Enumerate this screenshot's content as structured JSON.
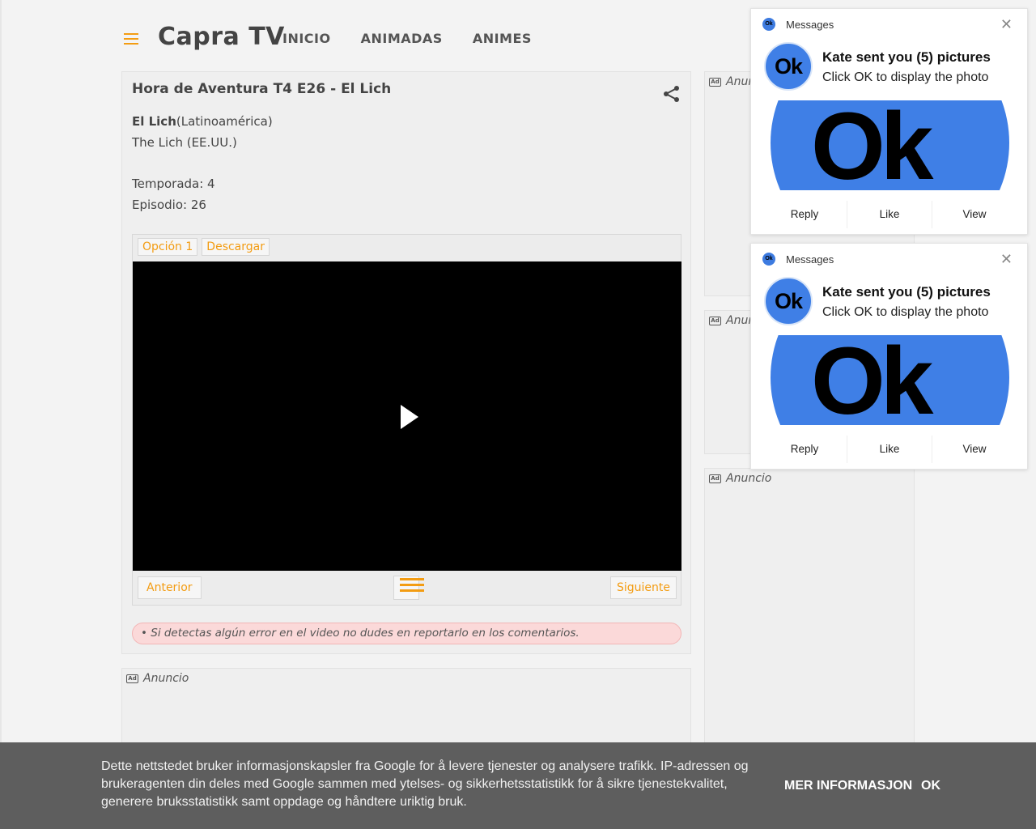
{
  "header": {
    "site_title": "Capra TV",
    "nav": [
      "INICIO",
      "ANIMADAS",
      "ANIMES"
    ]
  },
  "post": {
    "title": "Hora de Aventura T4 E26 - El Lich",
    "name_latam_bold": "El Lich",
    "name_latam_region": "(Latinoamérica)",
    "name_us": "The Lich (EE.UU.)",
    "season": "Temporada: 4",
    "episode": "Episodio: 26",
    "options": [
      "Opción 1",
      "Descargar"
    ],
    "prev_label": "Anterior",
    "next_label": "Siguiente",
    "error_note": "• Si detectas algún error en el video no dudes en reportarlo en los comentarios."
  },
  "ads": {
    "label": "Anuncio",
    "label_partial": "Anunc",
    "icon_text": "Ad"
  },
  "notifications": [
    {
      "app": "Messages",
      "avatar_text": "Ok",
      "title": "Kate sent you (5) pictures",
      "body": "Click OK to display the photo",
      "image_text": "Ok",
      "actions": [
        "Reply",
        "Like",
        "View"
      ]
    },
    {
      "app": "Messages",
      "avatar_text": "Ok",
      "title": "Kate sent you (5) pictures",
      "body": "Click OK to display the photo",
      "image_text": "Ok",
      "actions": [
        "Reply",
        "Like",
        "View"
      ]
    }
  ],
  "cookie": {
    "text": "Dette nettstedet bruker informasjonskapsler fra Google for å levere tjenester og analysere trafikk. IP-adressen og brukeragenten din deles med Google sammen med ytelses- og sikkerhetsstatistikk for å sikre tjenestekvalitet, generere bruksstatistikk samt oppdage og håndtere uriktig bruk.",
    "more_label": "MER INFORMASJON",
    "ok_label": "OK"
  },
  "colors": {
    "accent": "#f39c12",
    "notification_blue": "#3f7fe6",
    "cookie_bg": "#5e5e5e"
  }
}
